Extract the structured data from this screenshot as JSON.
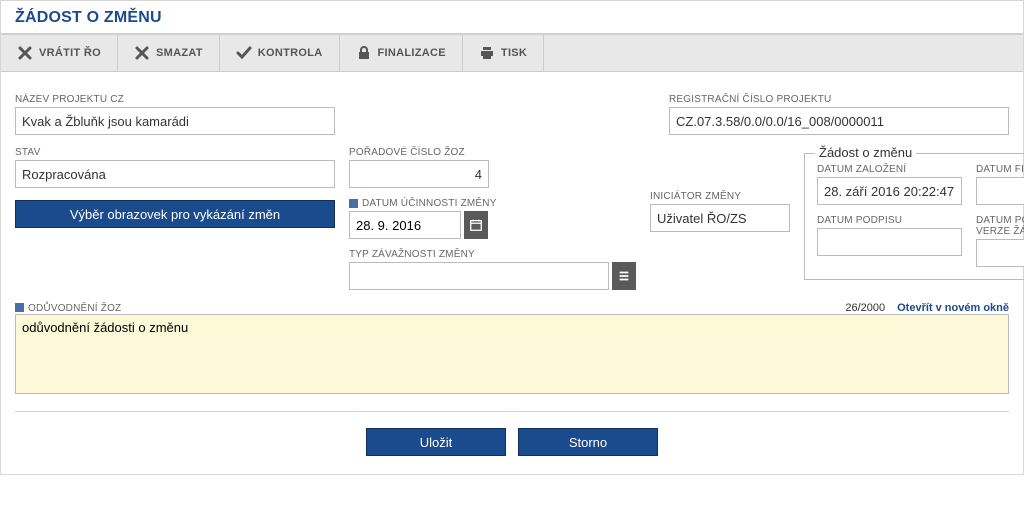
{
  "header": {
    "title": "ŽÁDOST O ZMĚNU"
  },
  "toolbar": {
    "vratit": "VRÁTIT ŘO",
    "smazat": "SMAZAT",
    "kontrola": "KONTROLA",
    "finalizace": "FINALIZACE",
    "tisk": "TISK"
  },
  "labels": {
    "nazev_projektu": "NÁZEV PROJEKTU CZ",
    "reg_cislo": "REGISTRAČNÍ ČÍSLO PROJEKTU",
    "stav": "STAV",
    "poradove": "POŘADOVÉ ČÍSLO ŽOZ",
    "datum_ucinnosti": "DATUM ÚČINNOSTI ZMĚNY",
    "iniciator": "INICIÁTOR ZMĚNY",
    "typ_zavaznosti": "TYP ZÁVAŽNOSTI ZMĚNY",
    "zadost_box": "Žádost o změnu",
    "datum_zalozeni": "DATUM ZALOŽENÍ",
    "datum_finalizace": "DATUM FINALIZACE",
    "datum_podpisu": "DATUM PODPISU",
    "datum_podani": "DATUM PODÁNÍ AKTUÁLNÍ VERZE ŽÁDOSTI",
    "oduvodneni": "ODŮVODNĚNÍ ŽOZ",
    "otevrit": "Otevřít v novém okně"
  },
  "buttons": {
    "vyber": "Výběr obrazovek pro vykázání změn",
    "ulozit": "Uložit",
    "storno": "Storno"
  },
  "values": {
    "nazev_projektu": "Kvak a Žbluňk jsou kamarádi",
    "reg_cislo": "CZ.07.3.58/0.0/0.0/16_008/0000011",
    "stav": "Rozpracována",
    "poradove": "4",
    "datum_ucinnosti": "28. 9. 2016",
    "iniciator": "Uživatel ŘO/ZS",
    "typ_zavaznosti": "",
    "datum_zalozeni": "28. září 2016 20:22:47",
    "datum_finalizace": "",
    "datum_podpisu": "",
    "datum_podani": "",
    "oduvodneni": "odůvodnění žádosti o změnu",
    "char_count": "26/2000"
  }
}
